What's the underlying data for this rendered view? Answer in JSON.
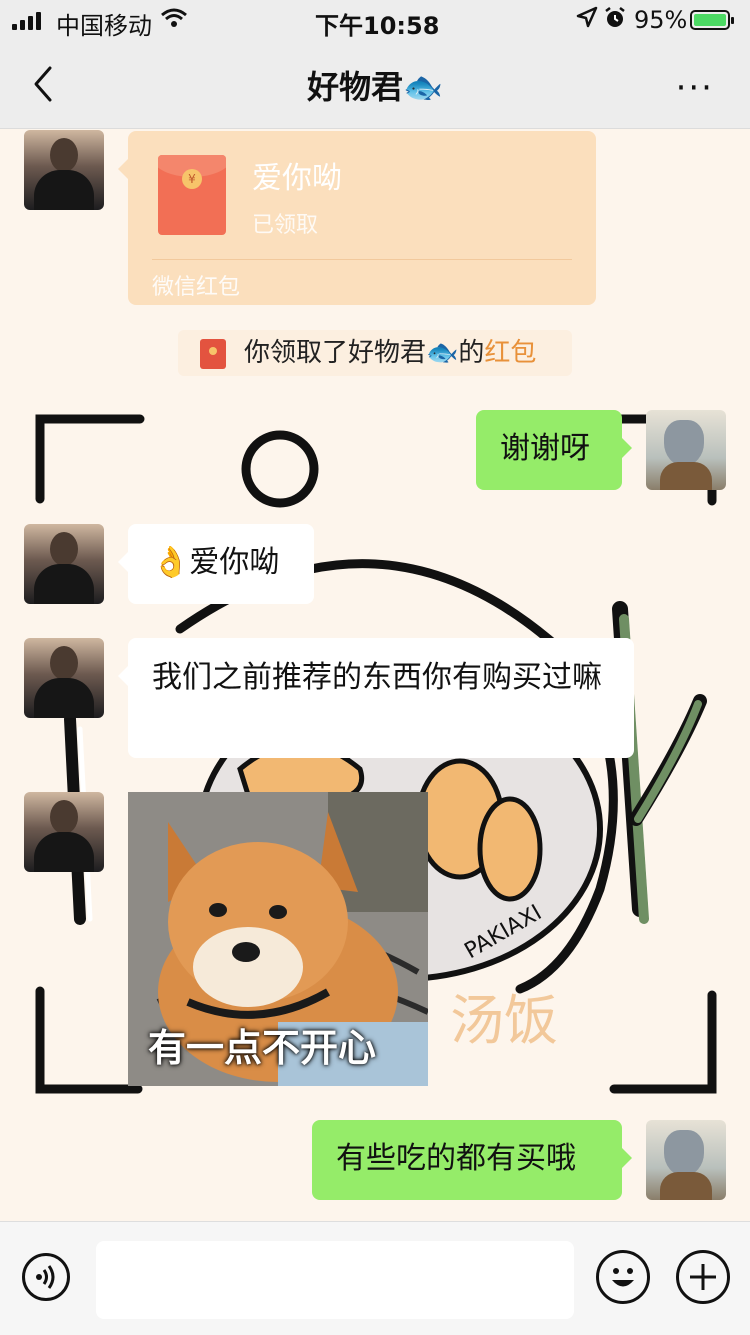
{
  "status_bar": {
    "carrier": "中国移动",
    "time": "下午10:58",
    "battery": "95%"
  },
  "nav": {
    "title": "好物君🐟",
    "more": "···"
  },
  "messages": {
    "red_packet": {
      "title": "爱你呦",
      "status": "已领取",
      "footer": "微信红包"
    },
    "notice": {
      "prefix": "你领取了好物君🐟的",
      "link": "红包"
    },
    "m1": "谢谢呀",
    "m2": "👌爱你呦",
    "m3": "我们之前推荐的东西你有购买过嘛",
    "sticker_caption": "有一点不开心",
    "m4": "有些吃的都有买哦"
  },
  "background_art": {
    "signature": "PAKIAXI",
    "handwriting": "汤饭"
  },
  "input_bar": {
    "value": ""
  }
}
